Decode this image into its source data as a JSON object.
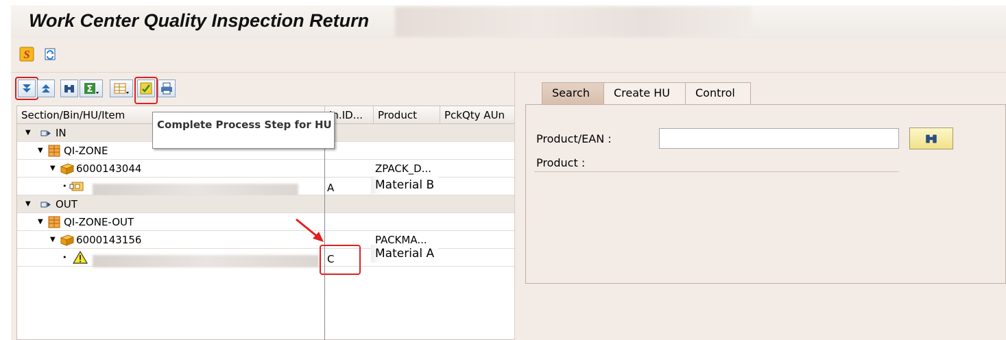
{
  "window": {
    "title": "Work Center Quality Inspection Return"
  },
  "app_toolbar": {
    "buttons": [
      {
        "icon": "sap-s-icon"
      },
      {
        "icon": "refresh-icon"
      }
    ]
  },
  "tree_toolbar": {
    "buttons": [
      {
        "icon": "expand-all-icon"
      },
      {
        "icon": "collapse-all-icon"
      },
      {
        "icon": "find-icon"
      },
      {
        "icon": "sum-icon"
      },
      {
        "icon": "layout-icon"
      },
      {
        "icon": "complete-step-icon"
      },
      {
        "icon": "print-icon"
      }
    ],
    "tooltip": "Complete Process Step for HU"
  },
  "tree": {
    "columns": [
      "Section/Bin/HU/Item",
      "In.ID...",
      "Product",
      "PckQty AUn"
    ],
    "rows": [
      {
        "label": "IN",
        "inid": "",
        "product": "",
        "kind": "section"
      },
      {
        "label": "QI-ZONE",
        "inid": "",
        "product": "",
        "kind": "bin"
      },
      {
        "label": "6000143044",
        "inid": "",
        "product": "ZPACK_D...",
        "kind": "hu"
      },
      {
        "label": "",
        "inid": "A",
        "product": "Material B",
        "kind": "item"
      },
      {
        "label": "OUT",
        "inid": "",
        "product": "",
        "kind": "section"
      },
      {
        "label": "QI-ZONE-OUT",
        "inid": "",
        "product": "",
        "kind": "bin"
      },
      {
        "label": "6000143156",
        "inid": "",
        "product": "PACKMA...",
        "kind": "hu"
      },
      {
        "label": "",
        "inid": "C",
        "product": "Material A",
        "kind": "item-warning"
      }
    ]
  },
  "right_panel": {
    "tabs": [
      "Search",
      "Create HU",
      "Control"
    ],
    "active_tab": "Search",
    "fields": {
      "product_ean_label": "Product/EAN :",
      "product_ean_value": "",
      "product_label": "Product :"
    }
  },
  "colors": {
    "background": "#f3ebe6",
    "annotation": "#e02020",
    "active_tab": "#d8bfae"
  }
}
